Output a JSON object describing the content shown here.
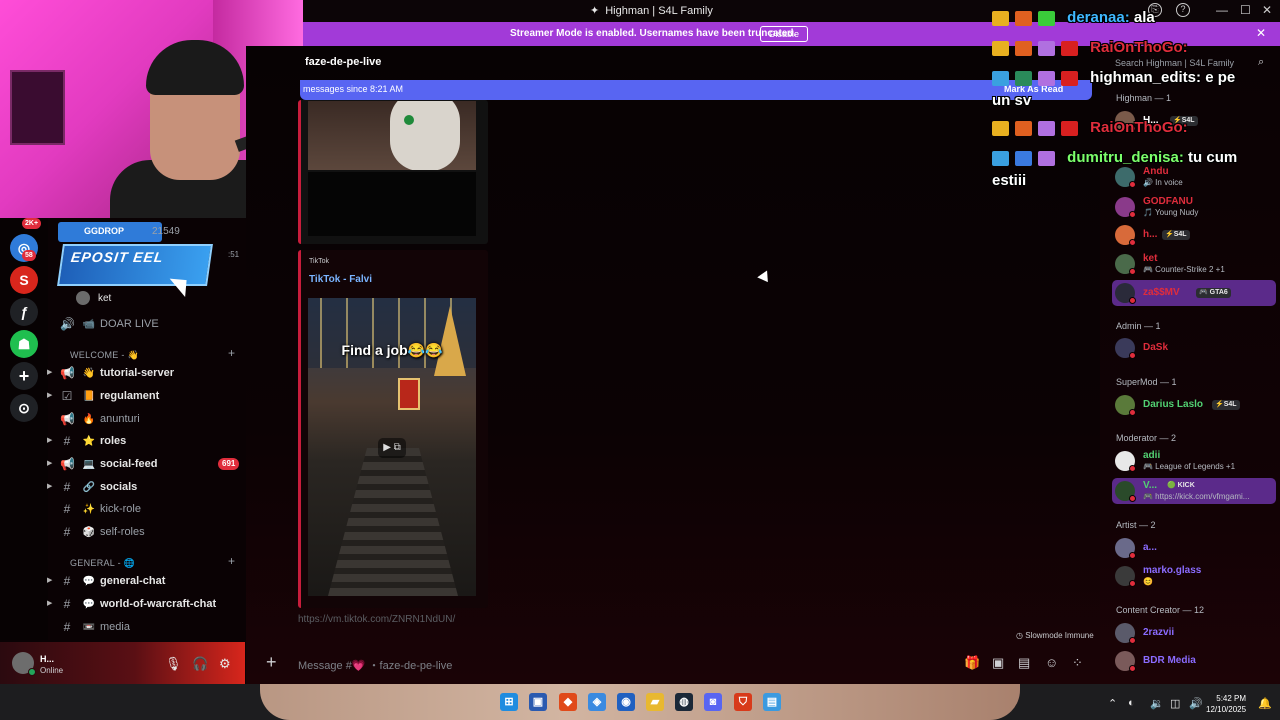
{
  "window": {
    "title": "Highman | S4L Family"
  },
  "banner": {
    "text": "Streamer Mode is enabled. Usernames have been truncated.",
    "disable_label": "Disable"
  },
  "channel": {
    "name": "faze-de-pe-live",
    "new_messages": "messages since 8:21 AM",
    "mark_read": "Mark As Read"
  },
  "promo": {
    "brand": "GGDROP",
    "headline": "EPOSIT EEL",
    "side_number": "21549",
    "side_time": ":51"
  },
  "server_rail": {
    "badge_top": "2K+",
    "badge_second": "58"
  },
  "channels": {
    "voice_user": "ket",
    "voice_channel": "DOAR LIVE",
    "categories": {
      "welcome": "WELCOME - 👋",
      "general": "GENERAL - 🌐"
    },
    "items": [
      {
        "label": "tutorial-server",
        "emoji": "👋"
      },
      {
        "label": "regulament",
        "emoji": "📙"
      },
      {
        "label": "anunturi",
        "emoji": "🔥"
      },
      {
        "label": "roles",
        "emoji": "⭐"
      },
      {
        "label": "social-feed",
        "emoji": "💻",
        "count": "691"
      },
      {
        "label": "socials",
        "emoji": "🔗"
      },
      {
        "label": "kick-role",
        "emoji": "✨"
      },
      {
        "label": "self-roles",
        "emoji": "🎲"
      },
      {
        "label": "general-chat",
        "emoji": "💬"
      },
      {
        "label": "world-of-warcraft-chat",
        "emoji": "💬"
      },
      {
        "label": "media",
        "emoji": "📼"
      }
    ]
  },
  "user_panel": {
    "name": "H...",
    "status": "Online"
  },
  "embed": {
    "provider": "TikTok",
    "title": "TikTok - Falvi",
    "caption": "Find a job😂😂",
    "link": "https://vm.tiktok.com/ZNRN1NdUN/"
  },
  "composer": {
    "placeholder": "Message #💗 ・faze-de-pe-live",
    "slowmode": "Slowmode Immune"
  },
  "members": {
    "search_placeholder": "Search Highman | S4L Family",
    "roles": {
      "highman": "Highman — 1",
      "admin": "Admin — 1",
      "supermod": "SuperMod — 1",
      "moderator": "Moderator — 2",
      "artist": "Artist — 2",
      "content_creator": "Content Creator — 12"
    },
    "list": [
      {
        "name": "H...",
        "tag": "⚡S4L",
        "color": "#ffffff"
      },
      {
        "name": "Andu",
        "sub": "🔊 In voice",
        "color": "#e02d3c"
      },
      {
        "name": "GODFANU",
        "sub": "🎵 Young Nudy",
        "color": "#e02d3c"
      },
      {
        "name": "h...",
        "tag": "⚡S4L",
        "color": "#e02d3c"
      },
      {
        "name": "ket",
        "sub": "🎮 Counter-Strike 2 +1",
        "color": "#e02d3c"
      },
      {
        "name": "za$$MV",
        "tag": "🎮 GTA6",
        "color": "#e02d3c"
      },
      {
        "name": "DaSk",
        "color": "#e02d3c"
      },
      {
        "name": "Darius Laslo",
        "tag": "⚡S4L",
        "color": "#52d273"
      },
      {
        "name": "adii",
        "sub": "🎮 League of Legends +1",
        "color": "#52d273"
      },
      {
        "name": "V...",
        "tag": "🟢 KICK",
        "sub": "🎮 https://kick.com/vfmgami...",
        "color": "#52d273"
      },
      {
        "name": "a...",
        "color": "#8b6cff"
      },
      {
        "name": "marko.glass",
        "sub": "😊",
        "color": "#8b6cff"
      },
      {
        "name": "2razvii",
        "color": "#8b6cff"
      },
      {
        "name": "BDR Media",
        "color": "#8b6cff"
      }
    ]
  },
  "overlay_chat": [
    {
      "user": "deranaa:",
      "msg": "ala",
      "color": "#3fb8ff"
    },
    {
      "user": "RaiOnThoGo:",
      "msg": "",
      "color": "#e02d3c"
    },
    {
      "user": "highman_edits:",
      "msg": "e pe",
      "color": "#ffffff"
    },
    {
      "user": "",
      "msg": "un sv",
      "color": "#ffffff"
    },
    {
      "user": "RaiOnThoGo:",
      "msg": "",
      "color": "#e02d3c"
    },
    {
      "user": "dumitru_denisa:",
      "msg": "tu cum",
      "color": "#7cff6b"
    },
    {
      "user": "",
      "msg": "estiii",
      "color": "#ffffff"
    }
  ],
  "taskbar": {
    "time": "5:42 PM",
    "date": "12/10/2025"
  },
  "colors": {
    "accent": "#a23ad8",
    "blurple": "#5865f2",
    "embed_border": "#c81d3c",
    "online": "#23a55a"
  }
}
